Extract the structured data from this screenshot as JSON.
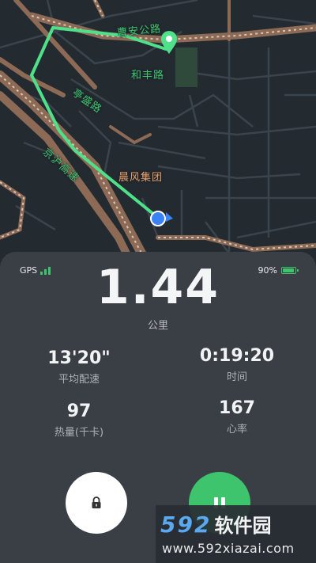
{
  "map": {
    "labels": {
      "road1": "曹安公路",
      "road2": "和丰路",
      "road3": "亭盛路",
      "road4": "京沪高速",
      "place": "晨风集团"
    },
    "colors": {
      "background": "#232a30",
      "road": "#3a444c",
      "highway": "#8c6a55",
      "route": "#4fe08a",
      "current_location": "#3b82f6",
      "destination_pin": "#4fe08a"
    }
  },
  "status": {
    "gps_label": "GPS",
    "battery_text": "90%",
    "battery_level": 0.9
  },
  "metrics": {
    "distance_value": "1.44",
    "distance_unit": "公里",
    "pace_value": "13'20\"",
    "pace_label": "平均配速",
    "time_value": "0:19:20",
    "time_label": "时间",
    "calories_value": "97",
    "calories_label": "热量(千卡)",
    "heart_rate_value": "167",
    "heart_rate_label": "心率"
  },
  "controls": {
    "lock_icon": "lock-icon",
    "pause_icon": "pause-icon"
  },
  "watermark": {
    "number": "592",
    "name": "软件园",
    "url": "www.592xiazai.com"
  }
}
